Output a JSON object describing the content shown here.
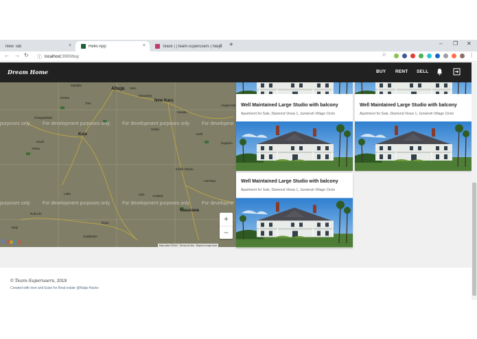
{
  "browser": {
    "tabs": [
      {
        "label": "New Tab"
      },
      {
        "label": "Hello App"
      },
      {
        "label": "Slack | | team-superusers | Naija"
      }
    ],
    "new_tab_symbol": "+",
    "close_symbol": "×",
    "window_controls": {
      "minimize": "–",
      "maximize": "❐",
      "close": "✕"
    },
    "url_host": "localhost",
    "url_path": ":3000/buy"
  },
  "app": {
    "brand": "Dream Home",
    "nav": {
      "buy": "BUY",
      "rent": "RENT",
      "sell": "SELL"
    }
  },
  "map": {
    "dev_text": "For development purposes only",
    "dev_text_short": "purposes only",
    "dev_text_cut": "For developme",
    "places": {
      "abuja": "Abuja",
      "new_karu": "New Karu",
      "kuje": "Kuje",
      "nasarawa": "Nasarawa",
      "gwagwalada": "Gwagwalada",
      "keffi": "Keffi",
      "kwali": "Kwali",
      "lafia": "Lafia",
      "mada": "Madalla",
      "gbeda": "Gwaru",
      "toto": "Toto",
      "rubochi": "Rubochi",
      "abaji": "Abaji",
      "gadabuke": "Gadabuke",
      "andaha": "Andaha",
      "lamingo": "Lamingo",
      "angwan": "Angwa Ma",
      "odu": "Odu",
      "bugu": "Bugu",
      "yelwa": "Yelwa",
      "gitata": "Gitata",
      "kagarko": "Kagarko",
      "karu": "Karu",
      "garaku": "Garaku",
      "keffi_keffin": "Keffin Shanu",
      "mararaba": "Mararaba"
    },
    "zoom_in": "+",
    "zoom_out": "−",
    "google": "Google",
    "footer": {
      "data": "Map data ©2019",
      "terms": "Terms of Use",
      "report": "Report a map error"
    }
  },
  "listings": [
    {
      "title": "Well Maintained Large Studio with balcony",
      "subtitle": "Apartment for Sale, Diamond Views 1, Jumeirah Village Circle"
    },
    {
      "title": "Well Maintained Large Studio with balcony",
      "subtitle": "Apartment for Sale, Diamond Views 1, Jumeirah Village Circle"
    },
    {
      "title": "Well Maintained Large Studio with balcony",
      "subtitle": "Apartment for Sale, Diamond Views 1, Jumeirah Village Circle"
    }
  ],
  "footer": {
    "brand": "Team-Superusers",
    "copyright_prefix": "© ",
    "copyright_year": ", 2019",
    "credit": "Created with love and Ease for Real estate @Naija-Hacks"
  },
  "colors": {
    "appbar": "#212121",
    "map": "#807e66",
    "accent_blue": "#1a73e8"
  }
}
